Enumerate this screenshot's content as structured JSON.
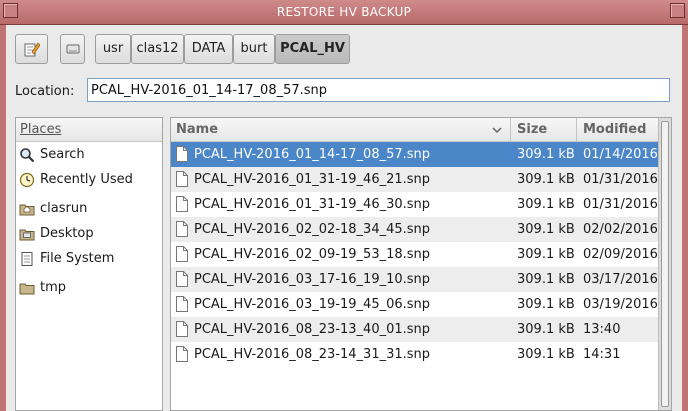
{
  "window": {
    "title": "RESTORE HV BACKUP"
  },
  "pathbar": {
    "segments": [
      "usr",
      "clas12",
      "DATA",
      "burt",
      "PCAL_HV"
    ],
    "active_index": 4
  },
  "location": {
    "label": "Location:",
    "value": "PCAL_HV-2016_01_14-17_08_57.snp"
  },
  "places": {
    "header": "Places",
    "items": [
      {
        "label": "Search",
        "icon": "search-icon"
      },
      {
        "label": "Recently Used",
        "icon": "clock-icon"
      },
      {
        "label": "clasrun",
        "icon": "home-folder-icon"
      },
      {
        "label": "Desktop",
        "icon": "desktop-folder-icon"
      },
      {
        "label": "File System",
        "icon": "drive-icon"
      },
      {
        "label": "tmp",
        "icon": "folder-icon"
      }
    ]
  },
  "files": {
    "columns": {
      "name": "Name",
      "size": "Size",
      "modified": "Modified"
    },
    "rows": [
      {
        "name": "PCAL_HV-2016_01_14-17_08_57.snp",
        "size": "309.1 kB",
        "modified": "01/14/2016",
        "selected": true
      },
      {
        "name": "PCAL_HV-2016_01_31-19_46_21.snp",
        "size": "309.1 kB",
        "modified": "01/31/2016"
      },
      {
        "name": "PCAL_HV-2016_01_31-19_46_30.snp",
        "size": "309.1 kB",
        "modified": "01/31/2016"
      },
      {
        "name": "PCAL_HV-2016_02_02-18_34_45.snp",
        "size": "309.1 kB",
        "modified": "02/02/2016"
      },
      {
        "name": "PCAL_HV-2016_02_09-19_53_18.snp",
        "size": "309.1 kB",
        "modified": "02/09/2016"
      },
      {
        "name": "PCAL_HV-2016_03_17-16_19_10.snp",
        "size": "309.1 kB",
        "modified": "03/17/2016"
      },
      {
        "name": "PCAL_HV-2016_03_19-19_45_06.snp",
        "size": "309.1 kB",
        "modified": "03/19/2016"
      },
      {
        "name": "PCAL_HV-2016_08_23-13_40_01.snp",
        "size": "309.1 kB",
        "modified": "13:40"
      },
      {
        "name": "PCAL_HV-2016_08_23-14_31_31.snp",
        "size": "309.1 kB",
        "modified": "14:31"
      }
    ]
  },
  "colors": {
    "titlebar": "#c07575",
    "selection": "#4a86c8",
    "window_bg": "#eaeaea"
  }
}
